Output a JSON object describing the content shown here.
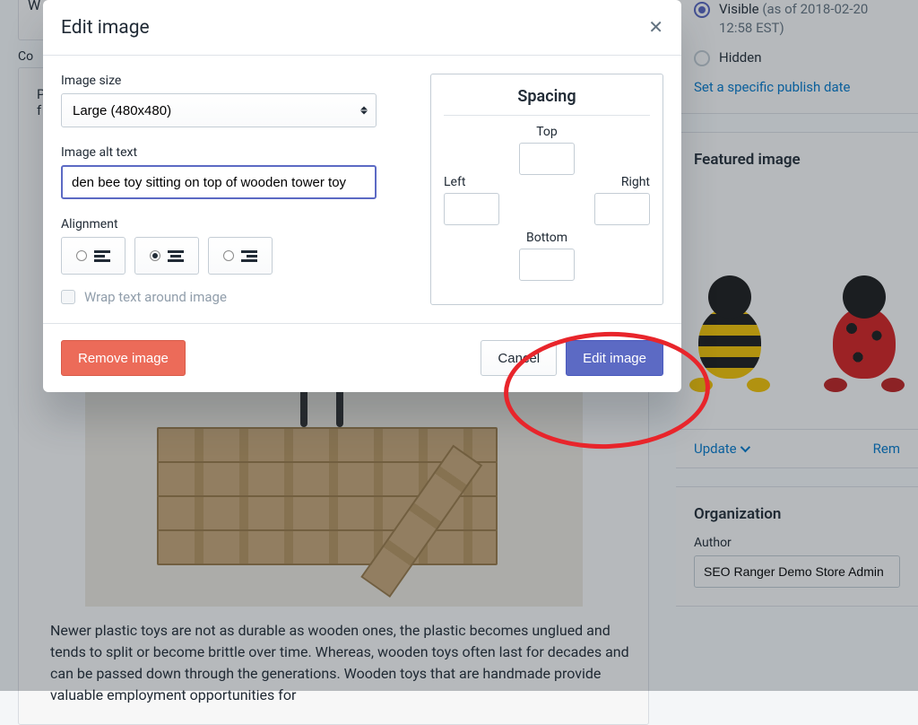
{
  "modal": {
    "title": "Edit image",
    "size_label": "Image size",
    "size_value": "Large (480x480)",
    "alt_label": "Image alt text",
    "alt_value": "den bee toy sitting on top of wooden tower toy",
    "alignment_label": "Alignment",
    "wrap_label": "Wrap text around image",
    "spacing": {
      "title": "Spacing",
      "top": "Top",
      "left": "Left",
      "right": "Right",
      "bottom": "Bottom"
    },
    "remove_btn": "Remove image",
    "cancel_btn": "Cancel",
    "edit_btn": "Edit image"
  },
  "bg": {
    "content_label": "Co",
    "partial_top_letter": "W",
    "partial_left_letters1": "P",
    "partial_left_letters2": "f",
    "body_text": "Newer plastic toys are not as durable as wooden ones, the plastic becomes unglued and tends to split or become brittle over time.  Whereas, wooden toys often last for decades and can be passed down through the generations. Wooden toys that are handmade provide valuable employment opportunities for"
  },
  "sidebar": {
    "visibility": {
      "visible_label": "Visible",
      "visible_sub": "(as of 2018-02-20 12:58 EST)",
      "hidden_label": "Hidden",
      "publish_link": "Set a specific publish date"
    },
    "featured": {
      "title": "Featured image",
      "update": "Update",
      "remove": "Rem"
    },
    "org": {
      "title": "Organization",
      "author_label": "Author",
      "author_value": "SEO Ranger Demo Store Admin"
    }
  }
}
